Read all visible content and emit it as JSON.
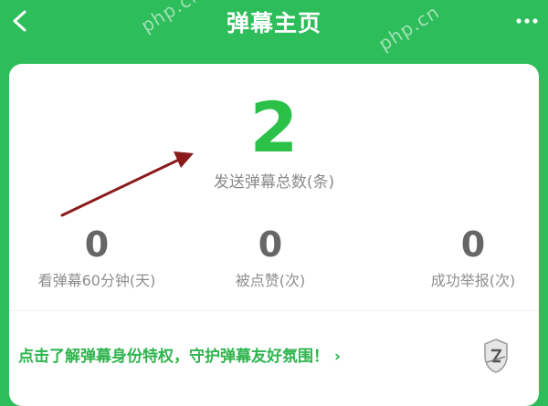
{
  "header": {
    "title": "弹幕主页",
    "back_icon": "chevron-left-icon",
    "more_icon": "more-dots-icon",
    "watermark": "php.cn"
  },
  "summary": {
    "total_count": "2",
    "total_label": "发送弹幕总数(条)"
  },
  "stats": [
    {
      "value": "0",
      "label": "看弹幕60分钟(天)"
    },
    {
      "value": "0",
      "label": "被点赞(次)"
    },
    {
      "value": "0",
      "label": "成功举报(次)"
    }
  ],
  "promo": {
    "text": "点击了解弹幕身份特权，守护弹幕友好氛围！",
    "chevron": "›",
    "badge_icon": "shield-badge-icon"
  },
  "colors": {
    "brand": "#2dbd5a",
    "count_green": "#2bc149",
    "annotation_arrow": "#8b1a1a"
  }
}
